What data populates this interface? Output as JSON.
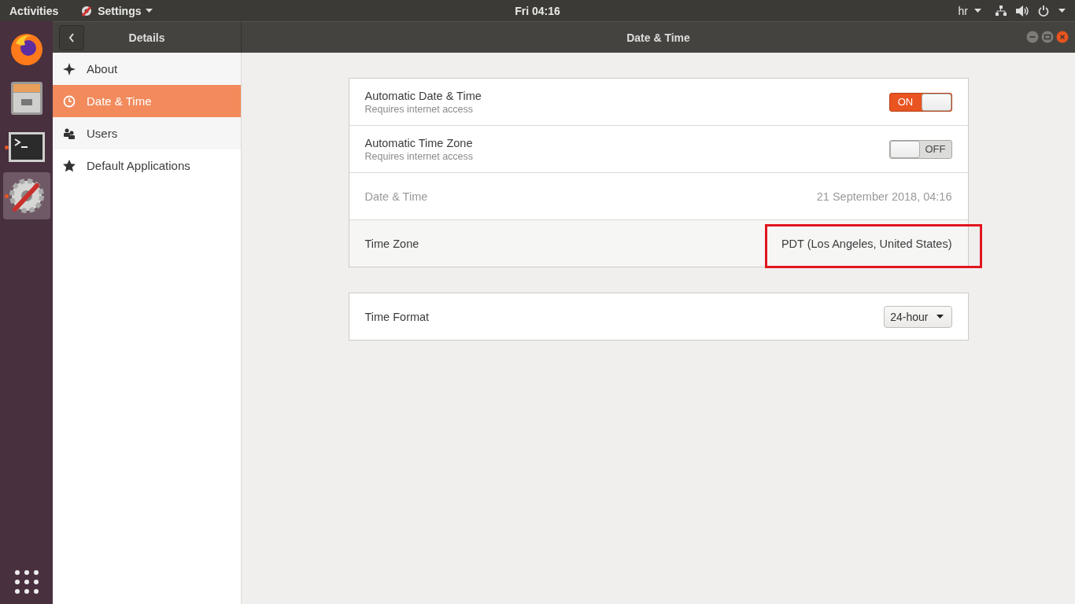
{
  "top_bar": {
    "activities": "Activities",
    "app_menu": "Settings",
    "clock": "Fri 04:16",
    "keyboard_layout": "hr"
  },
  "dock": [
    {
      "kind": "browser",
      "running": false,
      "selected": false
    },
    {
      "kind": "files",
      "running": false,
      "selected": false
    },
    {
      "kind": "terminal",
      "running": true,
      "selected": false
    },
    {
      "kind": "settings",
      "running": true,
      "selected": true
    }
  ],
  "sidebar": {
    "title": "Details",
    "items": [
      {
        "kind": "about",
        "label": "About",
        "selected": false
      },
      {
        "kind": "clock",
        "label": "Date & Time",
        "selected": true
      },
      {
        "kind": "users",
        "label": "Users",
        "selected": false
      },
      {
        "kind": "star",
        "label": "Default Applications",
        "selected": false
      }
    ]
  },
  "window": {
    "title": "Date & Time"
  },
  "groups": [
    [
      {
        "kind": "switch",
        "title": "Automatic Date & Time",
        "subtitle": "Requires internet access",
        "on": true,
        "label": "ON"
      },
      {
        "kind": "switch",
        "title": "Automatic Time Zone",
        "subtitle": "Requires internet access",
        "on": false,
        "label": "OFF"
      },
      {
        "kind": "value",
        "title": "Date & Time",
        "value": "21 September 2018, 04:16",
        "disabled": true,
        "hovered": false,
        "highlighted": false
      },
      {
        "kind": "value",
        "title": "Time Zone",
        "value": "PDT (Los Angeles, United States)",
        "disabled": false,
        "hovered": true,
        "highlighted": true
      }
    ],
    [
      {
        "kind": "dropdown",
        "title": "Time Format",
        "value": "24-hour"
      }
    ]
  ]
}
